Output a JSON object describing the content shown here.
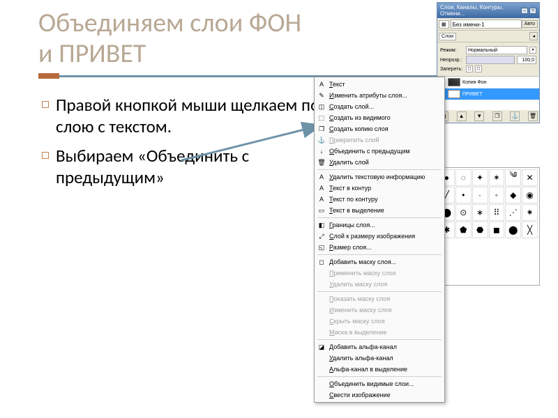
{
  "slide": {
    "title_line1": "Объединяем слои ФОН",
    "title_line2": " и ПРИВЕТ",
    "bullets": [
      "Правой кнопкой мыши щелкаем по слою с текстом.",
      "Выбираем «Объединить с предыдущим»"
    ]
  },
  "panel": {
    "window_title": "Слои, Каналы, Контуры, Отмени...",
    "image_selector": "Без имени-1",
    "auto_btn": "Авто",
    "section_layers": "Слои",
    "mode_label": "Режим:",
    "mode_value": "Нормальный",
    "opacity_label": "Непрозр.:",
    "opacity_value": "100,0",
    "lock_label": "Запереть:",
    "layer_kopia": "Копия Фон",
    "layer_privet": "ПРИВЕТ"
  },
  "context_menu": {
    "items": [
      {
        "icon": "A",
        "label": "Текст",
        "sep": false
      },
      {
        "icon": "✎",
        "label": "Изменить атрибуты слоя...",
        "sep": false
      },
      {
        "icon": "◫",
        "label": "Создать слой...",
        "sep": false
      },
      {
        "icon": "⬚",
        "label": "Создать из видимого",
        "sep": false
      },
      {
        "icon": "❐",
        "label": "Создать копию слоя",
        "sep": false
      },
      {
        "icon": "⚓",
        "label": "Прикрепить слой",
        "disabled": true,
        "sep": false
      },
      {
        "icon": "↓",
        "label": "Объединить с предыдущим",
        "sep": false
      },
      {
        "icon": "🗑",
        "label": "Удалить слой",
        "sep": true
      },
      {
        "icon": "A",
        "label": "Удалить текстовую информацию",
        "sep": false
      },
      {
        "icon": "A",
        "label": "Текст в контур",
        "sep": false
      },
      {
        "icon": "A",
        "label": "Текст по контуру",
        "sep": false
      },
      {
        "icon": "▭",
        "label": "Текст в выделение",
        "sep": true
      },
      {
        "icon": "◧",
        "label": "Границы слоя...",
        "sep": false
      },
      {
        "icon": "⤢",
        "label": "Слой к размеру изображения",
        "sep": false
      },
      {
        "icon": "◱",
        "label": "Размер слоя...",
        "sep": true
      },
      {
        "icon": "◻",
        "label": "Добавить маску слоя...",
        "sep": false
      },
      {
        "icon": "",
        "label": "Применить маску слоя",
        "disabled": true,
        "sep": false
      },
      {
        "icon": "",
        "label": "Удалить маску слоя",
        "disabled": true,
        "sep": true
      },
      {
        "icon": "",
        "label": "Показать маску слоя",
        "disabled": true,
        "sep": false
      },
      {
        "icon": "",
        "label": "Изменить маску слоя",
        "disabled": true,
        "sep": false
      },
      {
        "icon": "",
        "label": "Скрыть маску слоя",
        "disabled": true,
        "sep": false
      },
      {
        "icon": "",
        "label": "Маска в выделение",
        "disabled": true,
        "sep": true
      },
      {
        "icon": "◪",
        "label": "Добавить альфа-канал",
        "sep": false
      },
      {
        "icon": "",
        "label": "Удалить альфа-канал",
        "sep": false
      },
      {
        "icon": "",
        "label": "Альфа-канал в выделение",
        "sep": true
      },
      {
        "icon": "",
        "label": "Объединить видимые слои...",
        "sep": false
      },
      {
        "icon": "",
        "label": "Свести изображение",
        "sep": false
      }
    ]
  }
}
